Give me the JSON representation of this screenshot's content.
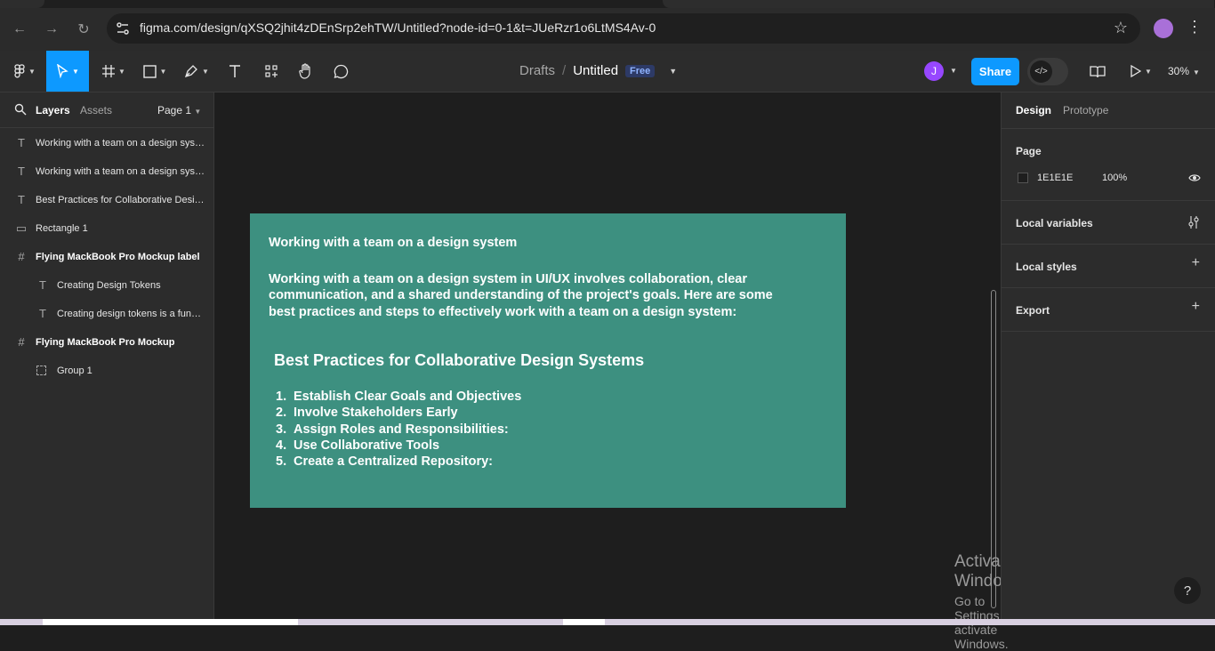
{
  "browser": {
    "url": "figma.com/design/qXSQ2jhit4zDEnSrp2ehTW/Untitled?node-id=0-1&t=JUeRzr1o6LtMS4Av-0"
  },
  "toolbar": {
    "breadcrumb_drafts": "Drafts",
    "breadcrumb_sep": "/",
    "file_name": "Untitled",
    "plan_badge": "Free",
    "avatar_initial": "J",
    "share_label": "Share",
    "zoom": "30%"
  },
  "left_panel": {
    "tab_layers": "Layers",
    "tab_assets": "Assets",
    "page": "Page 1",
    "layers": [
      {
        "name": "Working with a team on a design system",
        "type": "text"
      },
      {
        "name": "Working with a team on a design system in UI/UX involves collaboration",
        "type": "text"
      },
      {
        "name": "Best Practices for Collaborative Design Systems",
        "type": "text"
      },
      {
        "name": "Rectangle 1",
        "type": "rectangle"
      },
      {
        "name": "Flying MackBook Pro Mockup label",
        "type": "frame"
      },
      {
        "name": "Creating Design Tokens",
        "type": "text"
      },
      {
        "name": "Creating design tokens is a fundamental step",
        "type": "text"
      },
      {
        "name": "Flying MackBook Pro Mockup",
        "type": "frame"
      },
      {
        "name": "Group 1",
        "type": "group"
      }
    ]
  },
  "canvas": {
    "frame_color": "#3d9080",
    "title": "Working with a team on a design system",
    "paragraph": "Working with a team on a design system in UI/UX involves collaboration, clear communication, and a shared understanding of the project's goals. Here are some best practices and steps to effectively work with a team on a design system:",
    "heading": "Best Practices for Collaborative Design Systems",
    "list": [
      {
        "num": "1.",
        "text": "Establish Clear Goals and Objectives"
      },
      {
        "num": "2.",
        "text": "Involve Stakeholders Early"
      },
      {
        "num": "3.",
        "text": "Assign Roles and Responsibilities:"
      },
      {
        "num": "4.",
        "text": "Use Collaborative Tools"
      },
      {
        "num": "5.",
        "text": "Create a Centralized Repository:"
      }
    ],
    "activate_title": "Activate Windows",
    "activate_sub": "Go to Settings to activate Windows."
  },
  "right_panel": {
    "tab_design": "Design",
    "tab_prototype": "Prototype",
    "page_label": "Page",
    "page_color": "1E1E1E",
    "page_opacity": "100%",
    "local_variables": "Local variables",
    "local_styles": "Local styles",
    "export": "Export",
    "help": "?"
  },
  "accent_color": "#0d99ff"
}
